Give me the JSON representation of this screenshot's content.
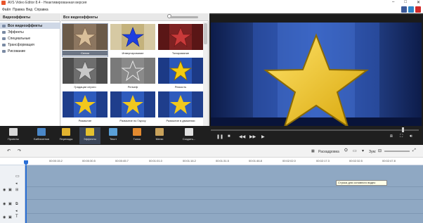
{
  "window": {
    "title": "AVS Video Editor 8.4 - Неактивированная версия",
    "controls": [
      "–",
      "□",
      "✕"
    ]
  },
  "menu": [
    "Файл",
    "Правка",
    "Вид",
    "Справка"
  ],
  "social_icons": [
    "facebook-icon",
    "twitter-icon",
    "youtube-icon"
  ],
  "effects_panel": {
    "header": "Видеоэффекты",
    "categories": [
      {
        "label": "Все видеоэффекты",
        "selected": true
      },
      {
        "label": "Эффекты",
        "selected": false
      },
      {
        "label": "Специальные",
        "selected": false
      },
      {
        "label": "Трансформация",
        "selected": false
      },
      {
        "label": "Рисование",
        "selected": false
      }
    ]
  },
  "gallery": {
    "header": "Все видеоэффекты",
    "tiles": [
      {
        "caption": "Сепия",
        "style": "sepia",
        "selected": true
      },
      {
        "caption": "Инвертирование",
        "style": "invert",
        "selected": false
      },
      {
        "caption": "Тонирование",
        "style": "tone",
        "selected": false
      },
      {
        "caption": "Градации серого",
        "style": "gray",
        "selected": false
      },
      {
        "caption": "Рельеф",
        "style": "relief",
        "selected": false
      },
      {
        "caption": "Резкость",
        "style": "sharp",
        "selected": false
      },
      {
        "caption": "Размытие",
        "style": "blur",
        "selected": false
      },
      {
        "caption": "Размытие по Гауссу",
        "style": "gauss",
        "selected": false
      },
      {
        "caption": "Размытие в движении",
        "style": "motion",
        "selected": false
      }
    ]
  },
  "preview": {
    "label": "Просмотр",
    "speed": "1x",
    "time": "00:00:02.740 / 00:00:03.000"
  },
  "toolbar": {
    "items": [
      {
        "label": "Проекты",
        "color": "#d9d9d9"
      },
      {
        "label": "Библиотека",
        "color": "#4a87c8"
      },
      {
        "label": "Переходы",
        "color": "#e3b32f"
      },
      {
        "label": "Эффекты",
        "color": "#e3c12f"
      },
      {
        "label": "Текст",
        "color": "#5aa0d8"
      },
      {
        "label": "Голос",
        "color": "#e38a2f"
      },
      {
        "label": "Меню",
        "color": "#c9a25b"
      }
    ],
    "create_label": "Создать..."
  },
  "timeline_toolbar": {
    "storyboard_label": "Раскадровка",
    "zoom_label": "Зум:"
  },
  "ruler": {
    "ticks": [
      "00:00:15.2",
      "00:00:30.5",
      "00:00:45.7",
      "00:01:01.0",
      "00:01:16.2",
      "00:01:31.5",
      "00:01:46.8",
      "00:02:02.0",
      "00:02:17.3",
      "00:02:32.5",
      "00:02:47.8"
    ]
  },
  "tooltip": "Строка для основного видео",
  "colors": {
    "toolbar_bg": "#1f1f1f",
    "timeline_bg": "#8fa8c3",
    "cursor": "#2a6fd6",
    "star_gold": "#f3c81b"
  }
}
